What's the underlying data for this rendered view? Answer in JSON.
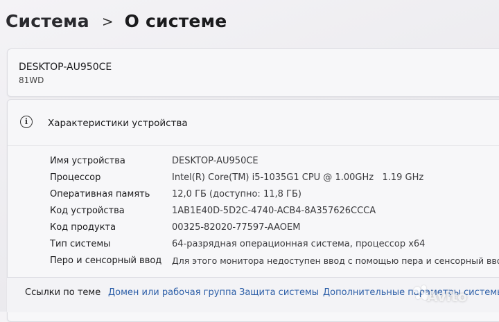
{
  "breadcrumb": {
    "parent": "Система",
    "separator": ">",
    "current": "О системе"
  },
  "device": {
    "name": "DESKTOP-AU950CE",
    "model": "81WD"
  },
  "specs": {
    "title": "Характеристики устройства",
    "icon": "info-icon",
    "rows": [
      {
        "label": "Имя устройства",
        "value": "DESKTOP-AU950CE"
      },
      {
        "label": "Процессор",
        "value": "Intel(R) Core(TM) i5-1035G1 CPU @ 1.00GHz   1.19 GHz"
      },
      {
        "label": "Оперативная память",
        "value": "12,0 ГБ (доступно: 11,8 ГБ)"
      },
      {
        "label": "Код устройства",
        "value": "1AB1E40D-5D2C-4740-ACB4-8A357626CCCA"
      },
      {
        "label": "Код продукта",
        "value": "00325-82020-77597-AAOEM"
      },
      {
        "label": "Тип системы",
        "value": "64-разрядная операционная система, процессор x64"
      },
      {
        "label": "Перо и сенсорный ввод",
        "value": "Для этого монитора недоступен ввод с помощью пера и сенсорный ввод"
      }
    ]
  },
  "links": {
    "label": "Ссылки по теме",
    "items": [
      "Домен или рабочая группа",
      "Защита системы",
      "Дополнительные параметры системы"
    ]
  },
  "watermark": {
    "text": "Avito"
  },
  "colors": {
    "link": "#2d5fa8",
    "card": "#f7f7f9",
    "background": "#ecebef"
  }
}
